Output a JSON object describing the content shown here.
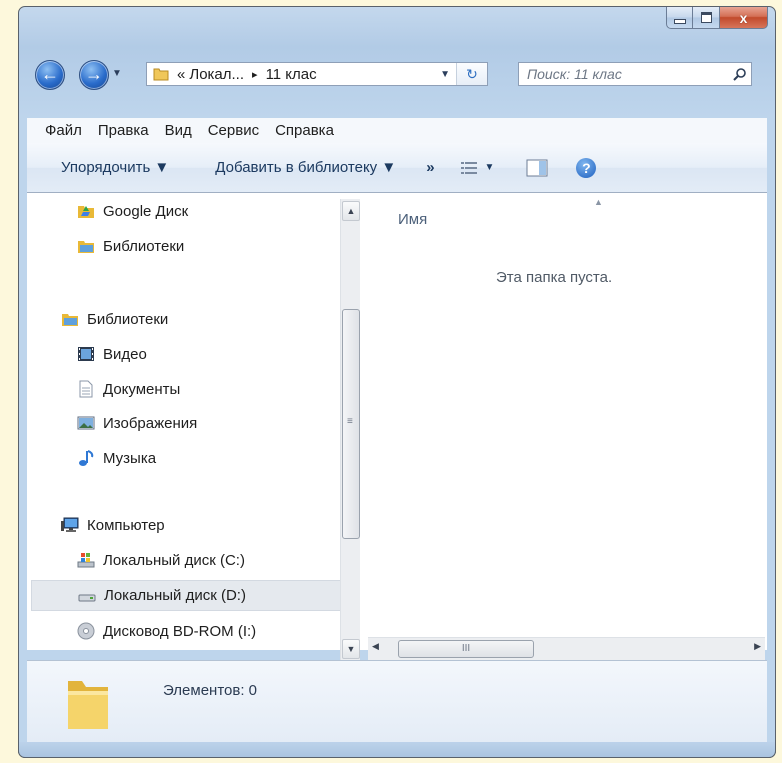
{
  "window": {
    "minimize": "–",
    "maximize": "□",
    "close": "x"
  },
  "address": {
    "overflow": "«",
    "crumb1": "Локал...",
    "sep": "▸",
    "crumb2": "11 клас",
    "dropdown": "▼",
    "refresh": "↻"
  },
  "search": {
    "placeholder": "Поиск: 11 клас"
  },
  "menu": [
    {
      "label": "Файл"
    },
    {
      "label": "Правка"
    },
    {
      "label": "Вид"
    },
    {
      "label": "Сервис"
    },
    {
      "label": "Справка"
    }
  ],
  "toolbar": {
    "organize": "Упорядочить ▼",
    "add_library": "Добавить в библиотеку ▼",
    "more": "»",
    "view_arrow": "▼"
  },
  "nav": {
    "google_drive": "Google Диск",
    "libraries_fav": "Библиотеки",
    "libraries": "Библиотеки",
    "video": "Видео",
    "documents": "Документы",
    "images": "Изображения",
    "music": "Музыка",
    "computer": "Компьютер",
    "disk_c": "Локальный диск (C:)",
    "disk_d": "Локальный диск (D:)",
    "bd_rom": "Дисковод BD-ROM (I:)"
  },
  "content": {
    "column_name": "Имя",
    "empty_message": "Эта папка пуста.",
    "hscroll_grip": "III",
    "vscroll_grip": "≡"
  },
  "status": {
    "items": "Элементов: 0"
  },
  "colors": {
    "accent": "#2a6ccb",
    "selection": "#e5e9ee",
    "window_frame": "#b2cbe6"
  }
}
